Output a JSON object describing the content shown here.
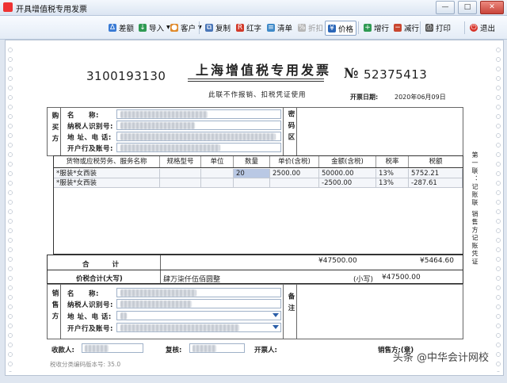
{
  "window": {
    "title": "开具增值税专用发票"
  },
  "toolbar": {
    "items": [
      {
        "label": "差额",
        "icon": "difference-icon"
      },
      {
        "label": "导入",
        "icon": "import-icon"
      },
      {
        "label": "客户",
        "icon": "customer-icon"
      },
      {
        "label": "复制",
        "icon": "copy-icon"
      },
      {
        "label": "红字",
        "icon": "red-invoice-icon"
      },
      {
        "label": "清单",
        "icon": "list-icon"
      },
      {
        "label": "折扣",
        "icon": "discount-icon"
      },
      {
        "label": "价格",
        "icon": "price-icon"
      },
      {
        "label": "增行",
        "icon": "add-row-icon"
      },
      {
        "label": "减行",
        "icon": "delete-row-icon"
      },
      {
        "label": "打印",
        "icon": "print-icon"
      },
      {
        "label": "退出",
        "icon": "exit-icon"
      }
    ]
  },
  "invoice": {
    "code": "3100193130",
    "title": "上海增值税专用发票",
    "no_sign": "№",
    "number": "52375413",
    "notice": "此联不作报销、扣税凭证使用",
    "date_label": "开票日期:",
    "date_value": "2020年06月09日"
  },
  "buyer": {
    "section_label": "购买方",
    "name_label": "名　　称:",
    "tax_id_label": "纳税人识别号:",
    "address_label": "地 址、电 话:",
    "bank_label": "开户行及账号:",
    "secret_label": "密码区"
  },
  "items_table": {
    "headers": [
      "货物或应税劳务、服务名称",
      "规格型号",
      "单位",
      "数量",
      "单价(含税)",
      "金额(含税)",
      "税率",
      "税额"
    ],
    "rows": [
      [
        "*服装*女西装",
        "",
        "",
        "20",
        "2500.00",
        "50000.00",
        "13%",
        "5752.21"
      ],
      [
        "*服装*女西装",
        "",
        "",
        "",
        "",
        "-2500.00",
        "13%",
        "-287.61"
      ]
    ]
  },
  "side_text": "第一联：记账联 销售方记账凭证",
  "totals": {
    "label": "合　　计",
    "amount": "¥47500.00",
    "tax": "¥5464.60"
  },
  "price_total": {
    "label": "价税合计(大写)",
    "uppercase": "肆万柒仟伍佰圆整",
    "lowercase_label": "(小写)",
    "lowercase_value": "¥47500.00"
  },
  "seller": {
    "section_label": "销售方",
    "name_label": "名　　称:",
    "tax_id_label": "纳税人识别号:",
    "address_label": "地 址、电 话:",
    "bank_label": "开户行及账号:",
    "remark_label": "备注"
  },
  "signers": {
    "payee_label": "收款人:",
    "reviewer_label": "复核:",
    "drawer_label": "开票人:",
    "seller_seal_label": "销售方:(章)"
  },
  "version": "税收分类编码版本号: 35.0",
  "watermark": "头条 @中华会计网校"
}
